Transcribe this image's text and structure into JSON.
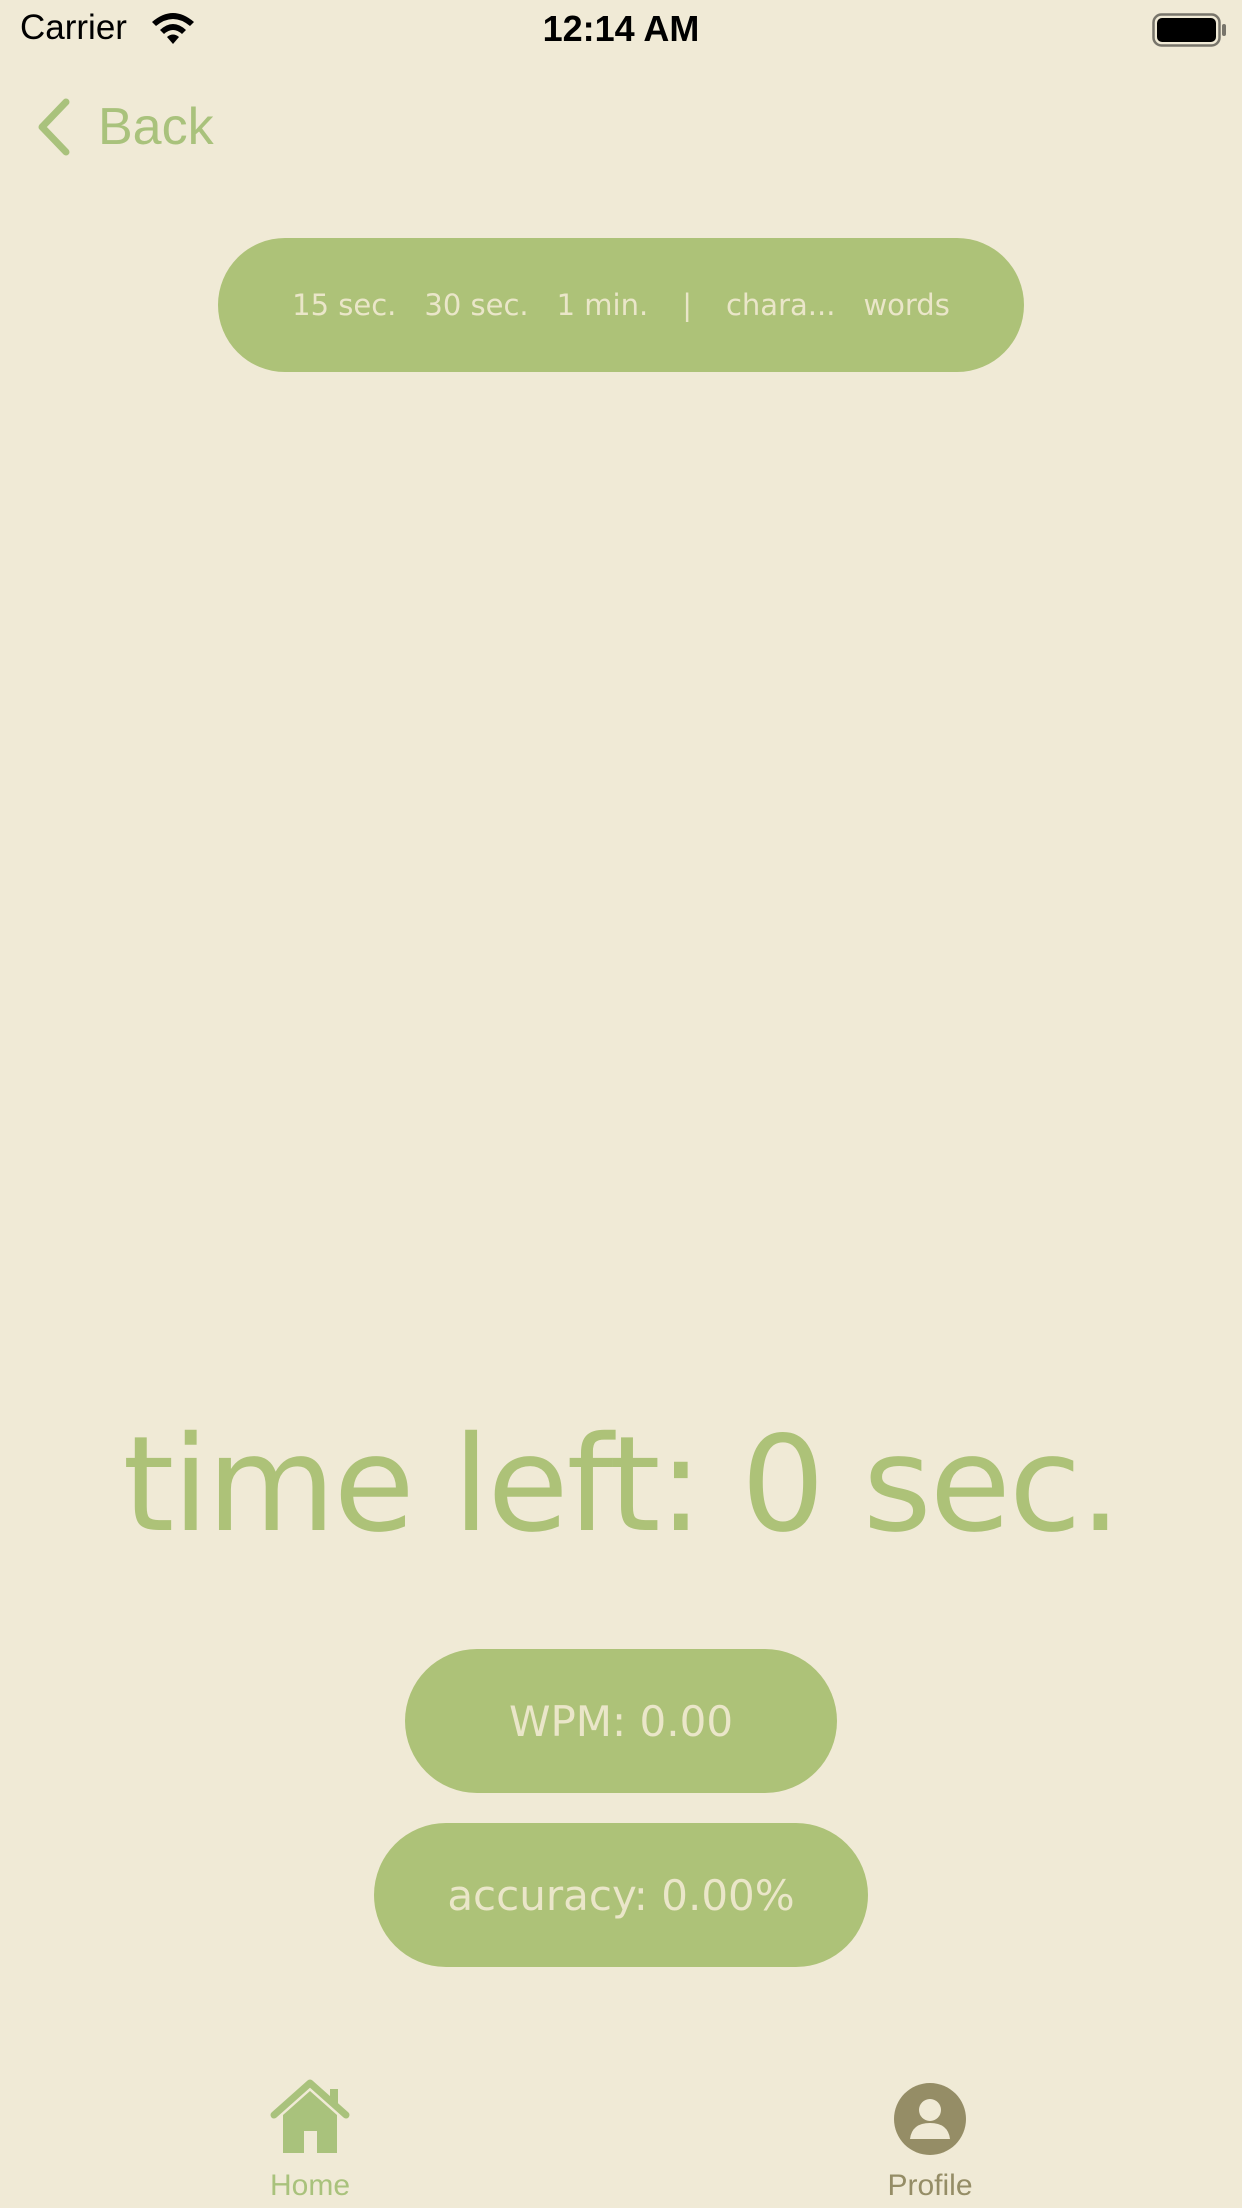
{
  "status_bar": {
    "carrier": "Carrier",
    "time": "12:14 AM"
  },
  "nav": {
    "back_label": "Back"
  },
  "mode_selector": {
    "options": [
      "15 sec.",
      "30 sec.",
      "1 min.",
      "chara...",
      "words"
    ],
    "separator": "|"
  },
  "timer": {
    "text": "time left: 0 sec."
  },
  "stats": {
    "wpm": "WPM: 0.00",
    "accuracy": "accuracy: 0.00%"
  },
  "tab_bar": {
    "tabs": [
      {
        "label": "Home",
        "icon": "home-icon",
        "active": true
      },
      {
        "label": "Profile",
        "icon": "profile-icon",
        "active": false
      }
    ]
  },
  "colors": {
    "background": "#f0ead6",
    "accent": "#adc278",
    "accent_text": "#eae6c9",
    "inactive_tab": "#958d66"
  }
}
